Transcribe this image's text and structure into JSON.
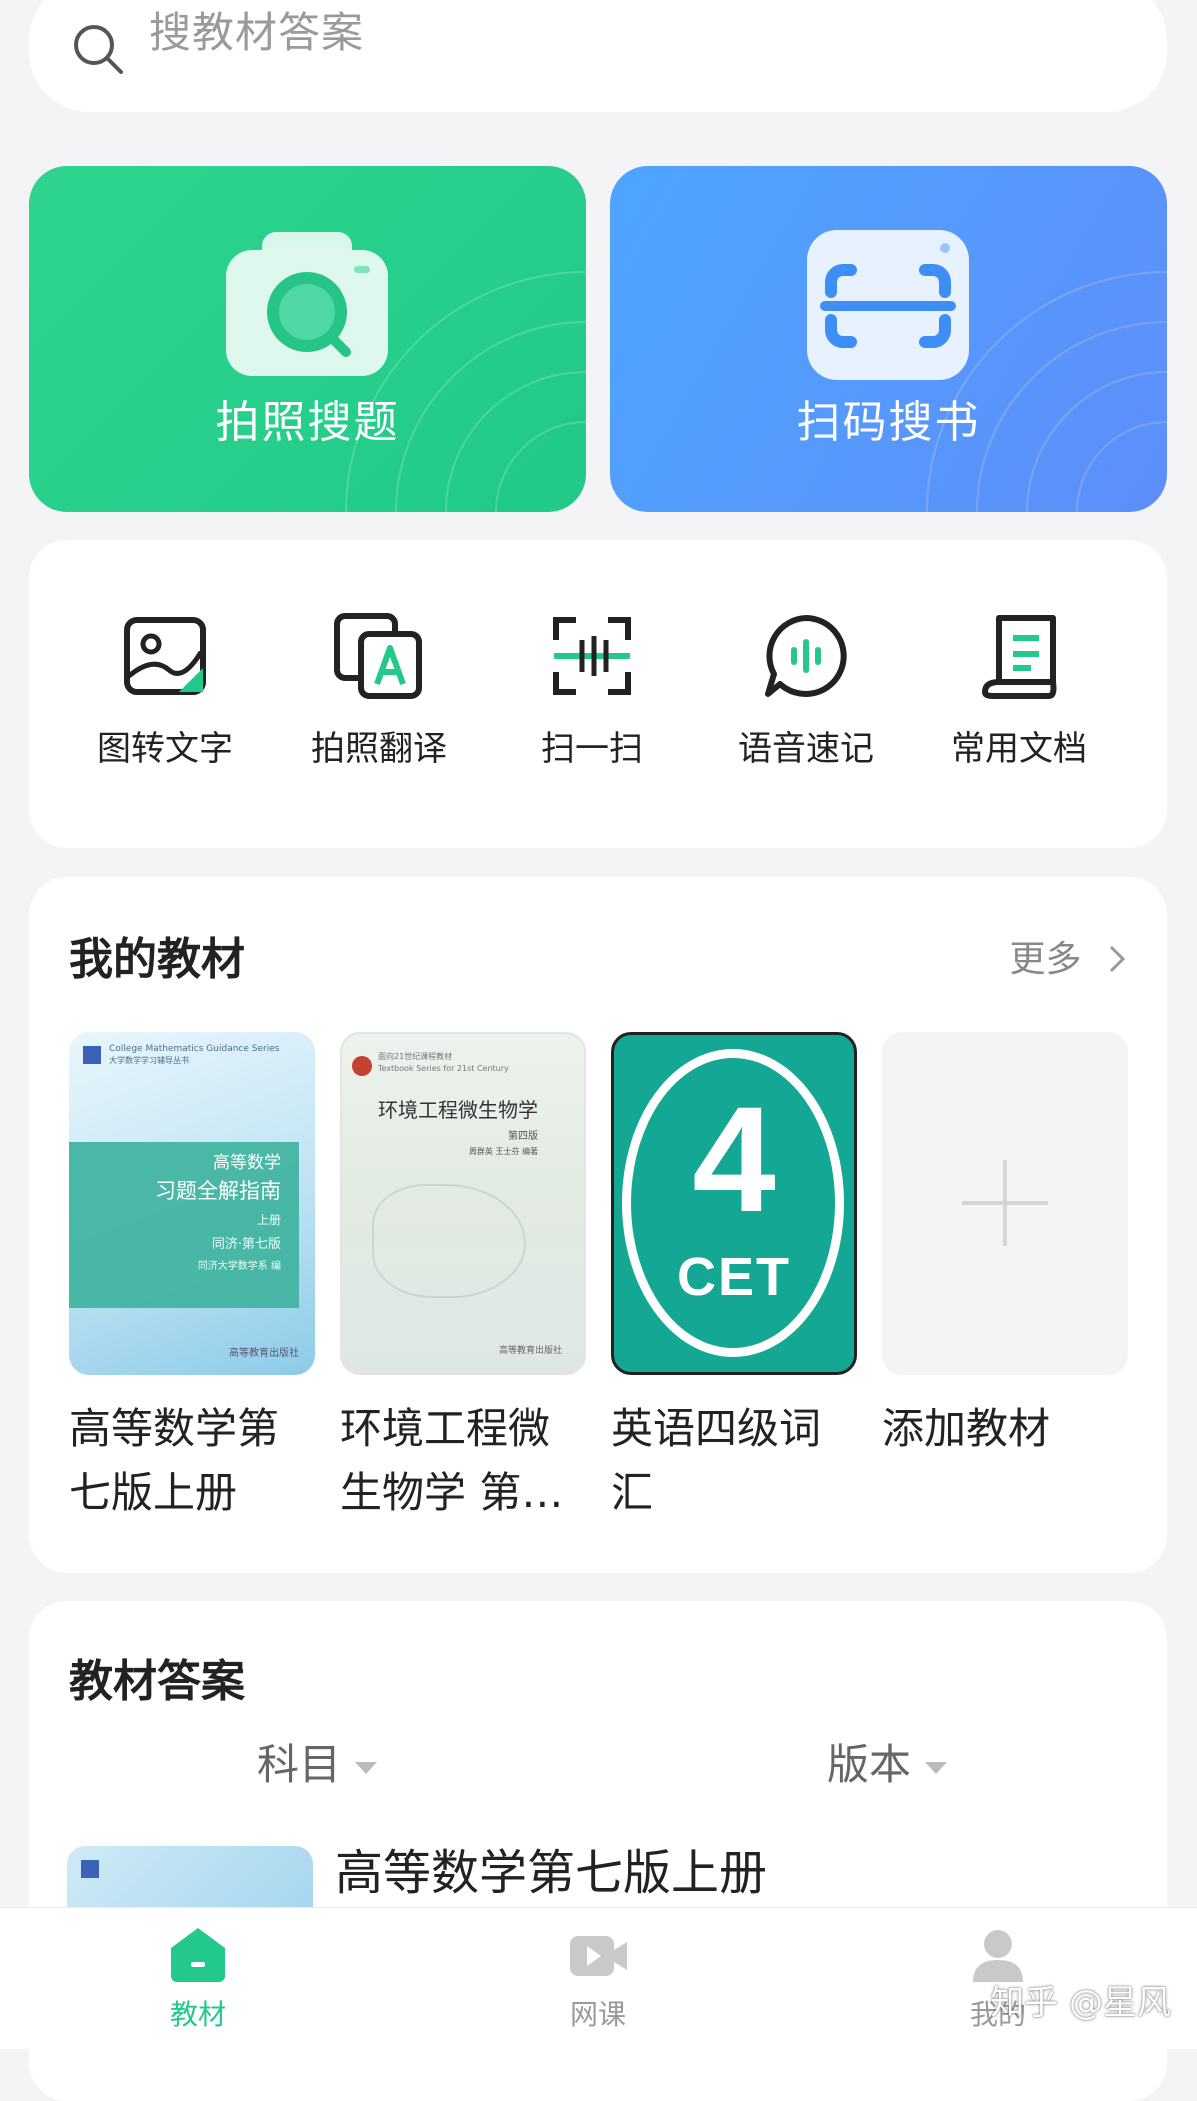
{
  "search": {
    "placeholder": "搜教材答案"
  },
  "hero": [
    {
      "label": "拍照搜题",
      "icon": "camera-search-icon",
      "color": "#27cf8c"
    },
    {
      "label": "扫码搜书",
      "icon": "scan-code-icon",
      "color": "#5598fb"
    }
  ],
  "tools": [
    {
      "label": "图转文字",
      "icon": "image-to-text-icon"
    },
    {
      "label": "拍照翻译",
      "icon": "photo-translate-icon"
    },
    {
      "label": "扫一扫",
      "icon": "scan-icon"
    },
    {
      "label": "语音速记",
      "icon": "voice-note-icon"
    },
    {
      "label": "常用文档",
      "icon": "document-icon"
    }
  ],
  "my_textbooks": {
    "title": "我的教材",
    "more_label": "更多",
    "books": [
      {
        "name": "高等数学第七版上册",
        "cover_lines": [
          "College Mathematics Guidance Series",
          "大学数学学习辅导丛书",
          "高等数学",
          "习题全解指南",
          "上册",
          "同济·第七版",
          "同济大学数学系 编",
          "高等教育出版社"
        ]
      },
      {
        "name": "环境工程微生物学 第…",
        "cover_lines": [
          "面向21世纪课程教材",
          "Textbook Series for 21st Century",
          "环境工程微生物学",
          "第四版",
          "周群英 王士芬 编著",
          "高等教育出版社"
        ]
      },
      {
        "name": "英语四级词汇",
        "cover_lines": [
          "4",
          "CET"
        ]
      },
      {
        "name": "添加教材"
      }
    ]
  },
  "answers": {
    "title": "教材答案",
    "filter_subject": "科目",
    "filter_edition": "版本",
    "first_item_title": "高等数学第七版上册"
  },
  "bottom_nav": [
    {
      "label": "教材",
      "icon": "home-icon",
      "active": true
    },
    {
      "label": "网课",
      "icon": "video-icon",
      "active": false
    },
    {
      "label": "我的",
      "icon": "profile-icon",
      "active": false
    }
  ],
  "watermark": "知乎 @星风",
  "colors": {
    "accent": "#23c98c",
    "inactive": "#9a9a9a"
  }
}
